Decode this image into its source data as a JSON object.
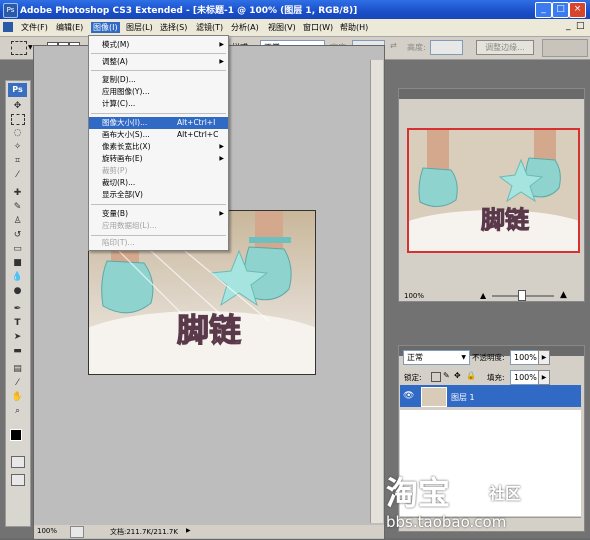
{
  "window": {
    "title": "Adobe Photoshop CS3 Extended - [未标题-1 @ 100% (图层 1, RGB/8)]",
    "app_badge": "Ps",
    "min": "_",
    "max": "□",
    "close": "×"
  },
  "menubar": {
    "file": "文件(F)",
    "edit": "编辑(E)",
    "image": "图像(I)",
    "layer": "图层(L)",
    "select": "选择(S)",
    "filter": "滤镜(T)",
    "analysis": "分析(A)",
    "view": "视图(V)",
    "window": "窗口(W)",
    "help": "帮助(H)"
  },
  "options": {
    "style_label": "样式:",
    "style_value": "正常",
    "width_label": "宽度:",
    "height_label": "高度:",
    "refine_button": "调整边缘..."
  },
  "image_menu": {
    "mode": "模式(M)",
    "adjustments": "调整(A)",
    "duplicate": "复制(D)...",
    "apply_image": "应用图像(Y)...",
    "calculations": "计算(C)...",
    "image_size": "图像大小(I)...",
    "image_size_shortcut": "Alt+Ctrl+I",
    "canvas_size": "画布大小(S)...",
    "canvas_size_shortcut": "Alt+Ctrl+C",
    "pixel_aspect": "像素长宽比(X)",
    "rotate_canvas": "旋转画布(E)",
    "crop": "裁剪(P)",
    "trim": "裁切(R)...",
    "reveal_all": "显示全部(V)",
    "variables": "变量(B)",
    "apply_data_set": "应用数据组(L)...",
    "trap": "陷印(T)..."
  },
  "canvas": {
    "art_text": "脚链"
  },
  "status": {
    "zoom": "100%",
    "doc_info": "文档:211.7K/211.7K"
  },
  "navigator": {
    "zoom": "100%"
  },
  "layers": {
    "blend_mode": "正常",
    "opacity_label": "不透明度:",
    "opacity_value": "100%",
    "lock_label": "锁定:",
    "fill_label": "填充:",
    "fill_value": "100%",
    "layer_name": "图层 1"
  },
  "watermark": {
    "brand": "淘宝",
    "badge": "社区",
    "url": "bbs.taobao.com"
  }
}
